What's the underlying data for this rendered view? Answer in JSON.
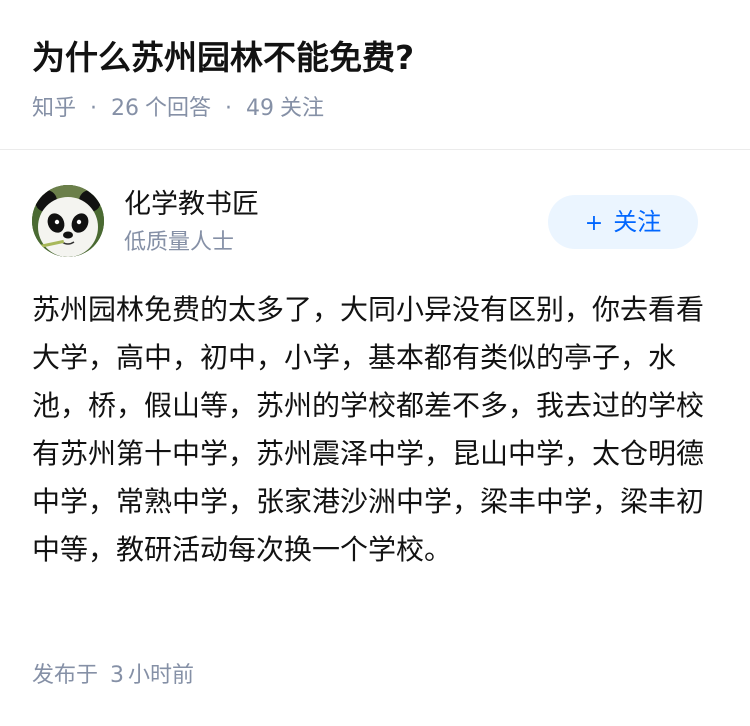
{
  "question": {
    "title": "为什么苏州园林不能免费?",
    "source": "知乎",
    "sep": "·",
    "answer_count": "26",
    "answer_label": "个回答",
    "follower_count": "49",
    "follower_label": "关注"
  },
  "author": {
    "name": "化学教书匠",
    "tag": "低质量人士",
    "avatar_icon": "panda-avatar"
  },
  "follow_button": {
    "plus": "+",
    "label": "关注"
  },
  "answer": {
    "content": "苏州园林免费的太多了，大同小异没有区别，你去看看大学，高中，初中，小学，基本都有类似的亭子，水池，桥，假山等，苏州的学校都差不多，我去过的学校有苏州第十中学，苏州震泽中学，昆山中学，太仓明德中学，常熟中学，张家港沙洲中学，梁丰中学，梁丰初中等，教研活动每次换一个学校。",
    "publish_label": "发布于",
    "publish_num": "3",
    "publish_unit": "小时前"
  },
  "colors": {
    "meta_gray": "#8590a6",
    "brand_blue": "#0066ff",
    "button_bg": "#ebf5ff"
  }
}
